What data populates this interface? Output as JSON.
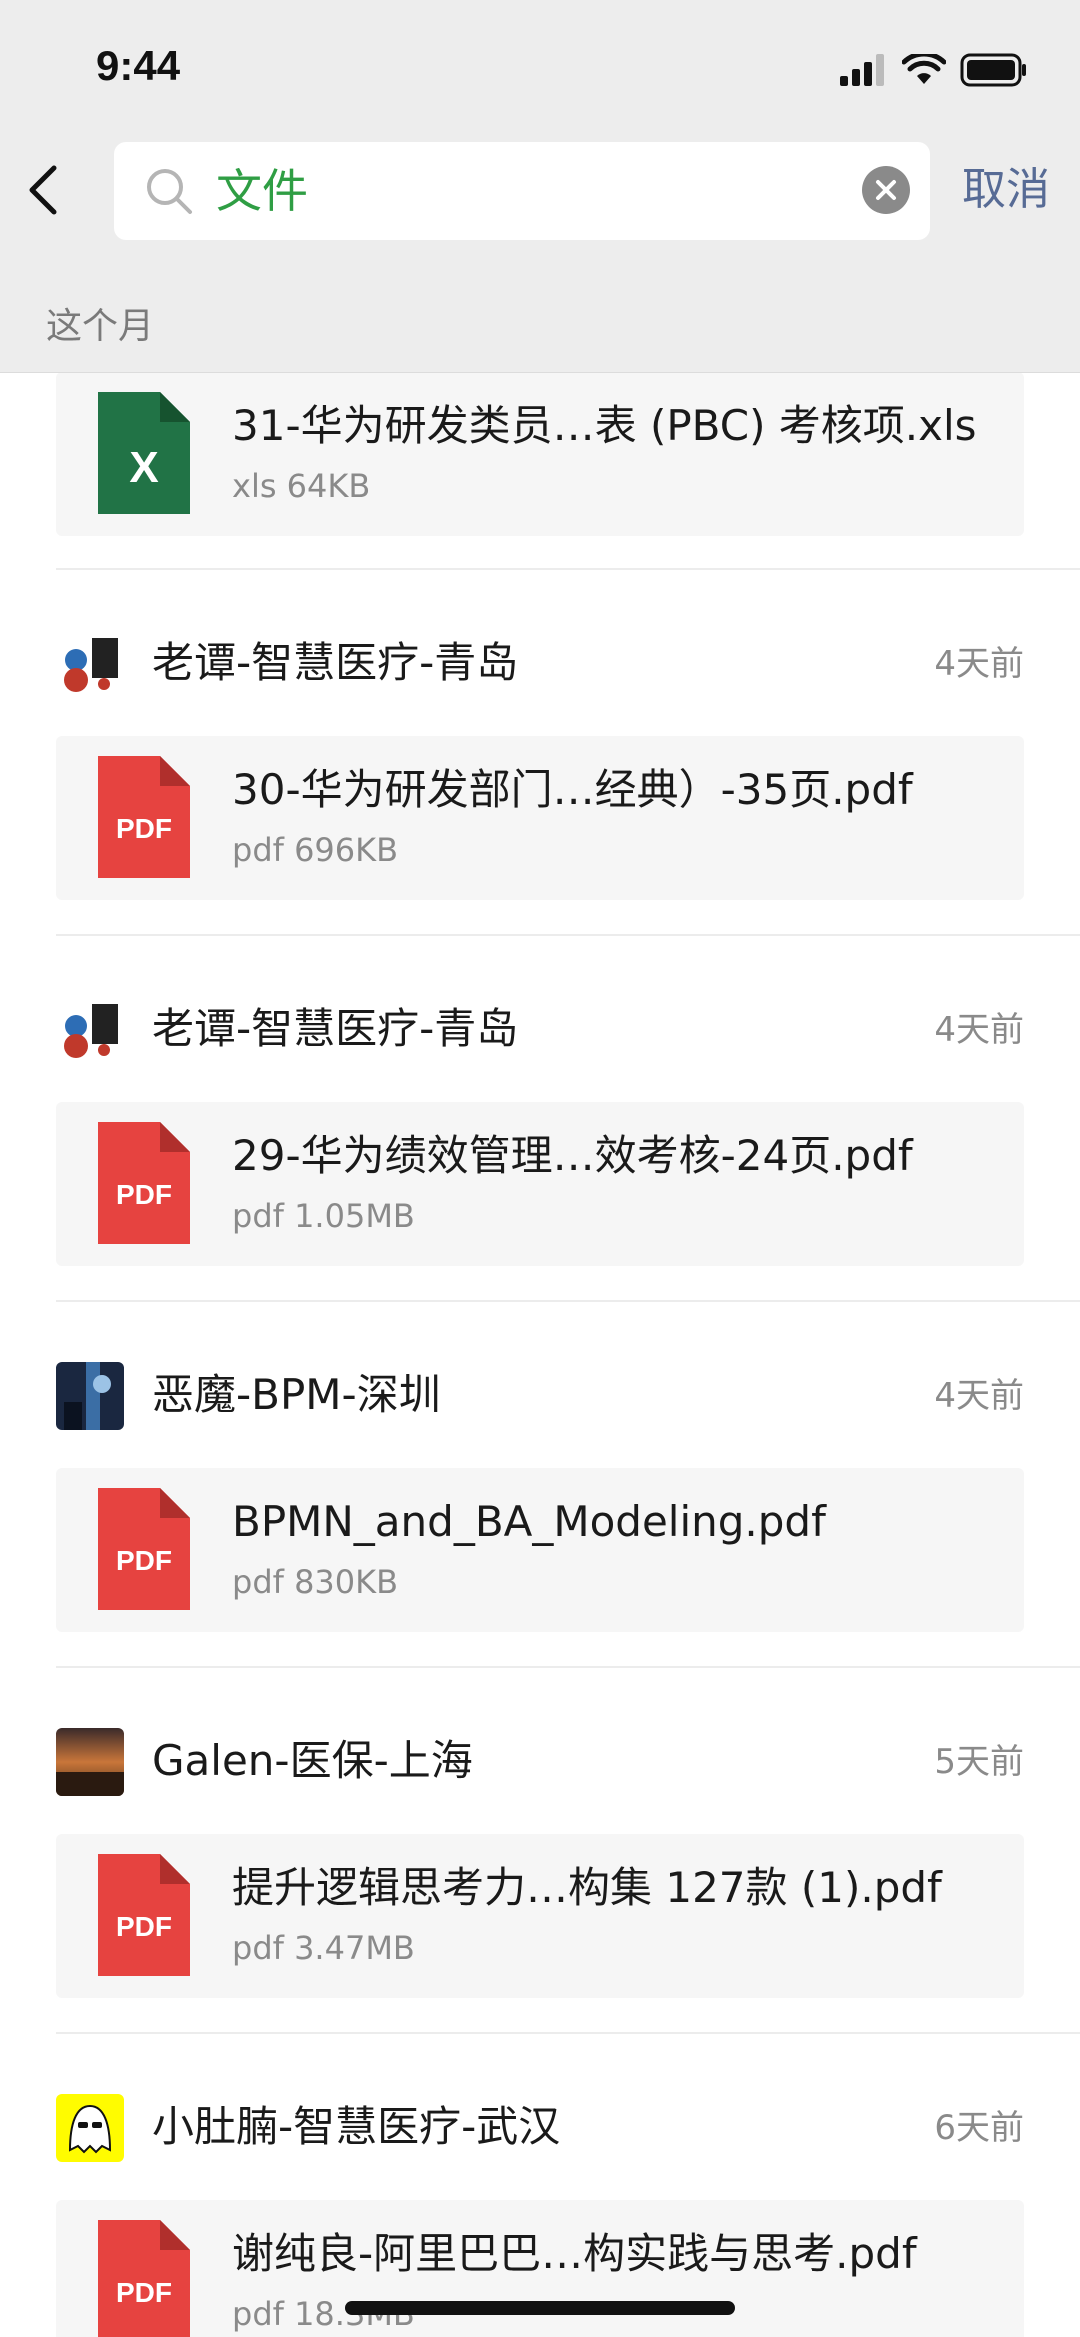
{
  "status_bar": {
    "time": "9:44"
  },
  "header": {
    "search_value": "文件",
    "cancel_label": "取消",
    "section_label": "这个月"
  },
  "colors": {
    "accent_green": "#2f9e44",
    "link_blue": "#576b95",
    "pdf_red": "#e64340",
    "xls_green": "#217346"
  },
  "items": [
    {
      "file": {
        "type_icon": "xls-file-icon",
        "badge": "X",
        "name": "31-华为研发类员…表 (PBC) 考核项.xls",
        "meta": "xls 64KB"
      }
    },
    {
      "sender": {
        "avatar": "cartoon-avatar",
        "name": "老谭-智慧医疗-青岛",
        "time": "4天前"
      },
      "file": {
        "type_icon": "pdf-file-icon",
        "badge": "PDF",
        "name": "30-华为研发部门…经典）-35页.pdf",
        "meta": "pdf 696KB"
      }
    },
    {
      "sender": {
        "avatar": "cartoon-avatar",
        "name": "老谭-智慧医疗-青岛",
        "time": "4天前"
      },
      "file": {
        "type_icon": "pdf-file-icon",
        "badge": "PDF",
        "name": "29-华为绩效管理…效考核-24页.pdf",
        "meta": "pdf 1.05MB"
      }
    },
    {
      "sender": {
        "avatar": "photo-avatar",
        "name": "恶魔-BPM-深圳",
        "time": "4天前"
      },
      "file": {
        "type_icon": "pdf-file-icon",
        "badge": "PDF",
        "name": "BPMN_and_BA_Modeling.pdf",
        "meta": "pdf 830KB"
      }
    },
    {
      "sender": {
        "avatar": "sunset-avatar",
        "name": "Galen-医保-上海",
        "time": "5天前"
      },
      "file": {
        "type_icon": "pdf-file-icon",
        "badge": "PDF",
        "name": "提升逻辑思考力…构集 127款 (1).pdf",
        "meta": "pdf 3.47MB"
      }
    },
    {
      "sender": {
        "avatar": "ghost-avatar",
        "name": "小肚腩-智慧医疗-武汉",
        "time": "6天前"
      },
      "file": {
        "type_icon": "pdf-file-icon",
        "badge": "PDF",
        "name": "谢纯良-阿里巴巴…构实践与思考.pdf",
        "meta": "pdf 18.3MB"
      }
    }
  ]
}
